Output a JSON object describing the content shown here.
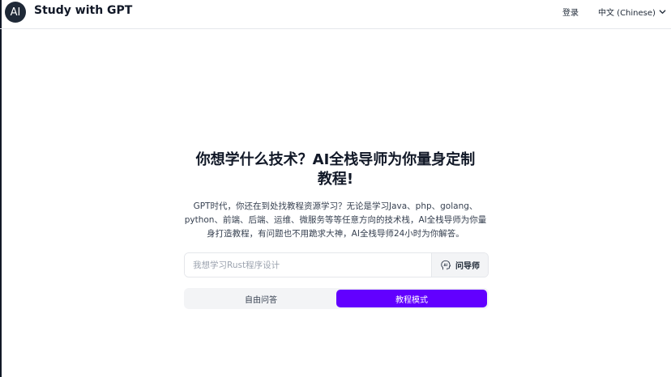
{
  "header": {
    "logo_text": "AI",
    "brand": "Study with GPT",
    "login_label": "登录",
    "language_label": "中文 (Chinese)"
  },
  "hero": {
    "title_line1": "你想学什么技术？AI全栈导师为你量身定制",
    "title_line2": "教程!",
    "desc_line1": "GPT时代，你还在到处找教程资源学习？无论是学习Java、php、golang、",
    "desc_line2": "python、前端、后端、运维、微服务等等任意方向的技术栈，AI全栈导师为你量",
    "desc_line3": "身打造教程，有问题也不用跪求大神，AI全栈导师24小时为你解答。"
  },
  "search": {
    "placeholder": "我想学习Rust程序设计",
    "value": "",
    "ask_label": "问导师"
  },
  "modes": [
    {
      "label": "自由问答",
      "active": false
    },
    {
      "label": "教程模式",
      "active": true
    }
  ],
  "colors": {
    "accent": "#6200ff",
    "logo_bg": "#1f2937"
  }
}
